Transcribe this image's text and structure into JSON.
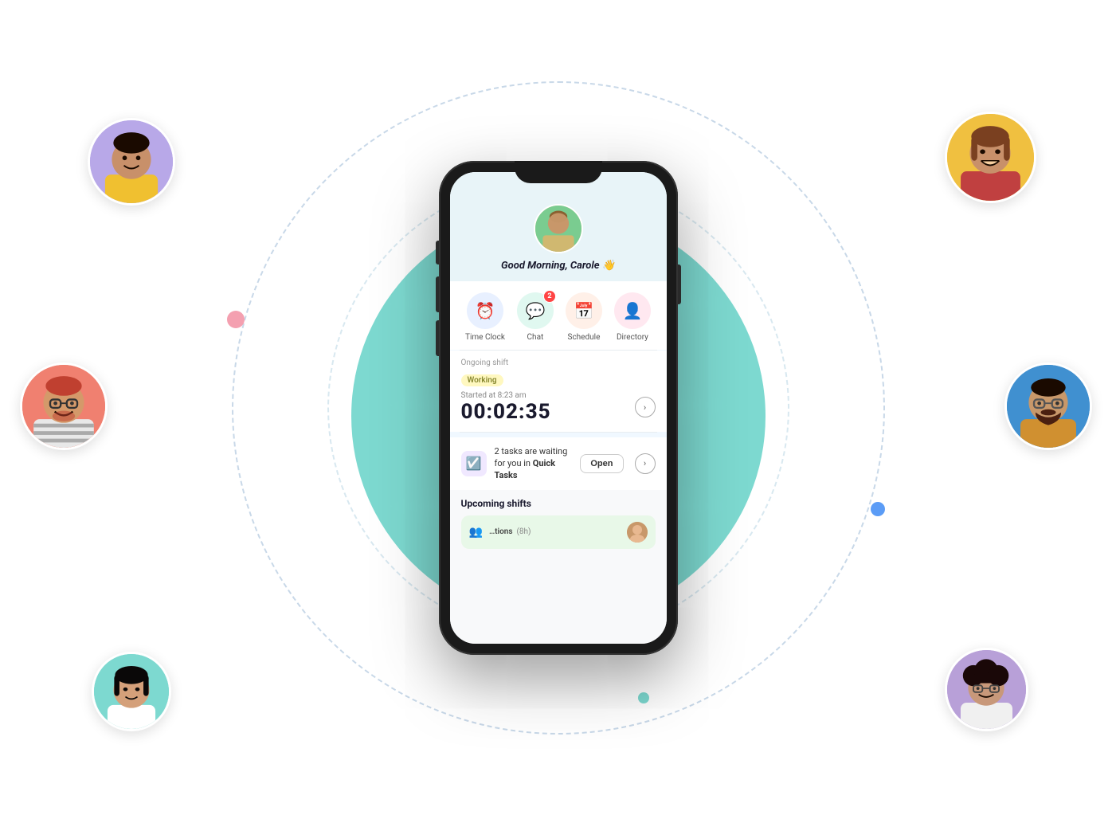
{
  "background": {
    "teal_color": "#7accc8",
    "outer_circle_color": "#c8d8e8",
    "inner_circle_color": "#d8e8f0"
  },
  "avatars": {
    "top_left": {
      "bg": "#b8a8e8",
      "label": "young man yellow shirt"
    },
    "mid_left": {
      "bg": "#f08070",
      "label": "man with glasses"
    },
    "bot_left": {
      "bg": "#7dd9d0",
      "label": "asian woman"
    },
    "top_right": {
      "bg": "#f0c040",
      "label": "woman laughing"
    },
    "mid_right": {
      "bg": "#4090d0",
      "label": "man with beard glasses"
    },
    "bot_right": {
      "bg": "#b8a0d8",
      "label": "woman curly hair glasses"
    }
  },
  "phone": {
    "greeting": "Good Morning, Carole 👋",
    "app_icons": [
      {
        "label": "Time Clock",
        "icon": "⏰",
        "color": "blue",
        "badge": null
      },
      {
        "label": "Chat",
        "icon": "💬",
        "color": "teal",
        "badge": "2"
      },
      {
        "label": "Schedule",
        "icon": "📅",
        "color": "orange",
        "badge": null
      },
      {
        "label": "Directory",
        "icon": "👤",
        "color": "pink",
        "badge": null
      }
    ],
    "shift": {
      "label": "Ongoing shift",
      "status": "Working",
      "started_text": "Started at 8:23 am",
      "timer": "00:02:35"
    },
    "tasks": {
      "message": "2 tasks are waiting for you in",
      "bold_part": "Quick Tasks",
      "button_label": "Open"
    },
    "upcoming": {
      "title": "Upcoming shifts",
      "card_text": "tions",
      "card_hours": "(8h)"
    }
  }
}
